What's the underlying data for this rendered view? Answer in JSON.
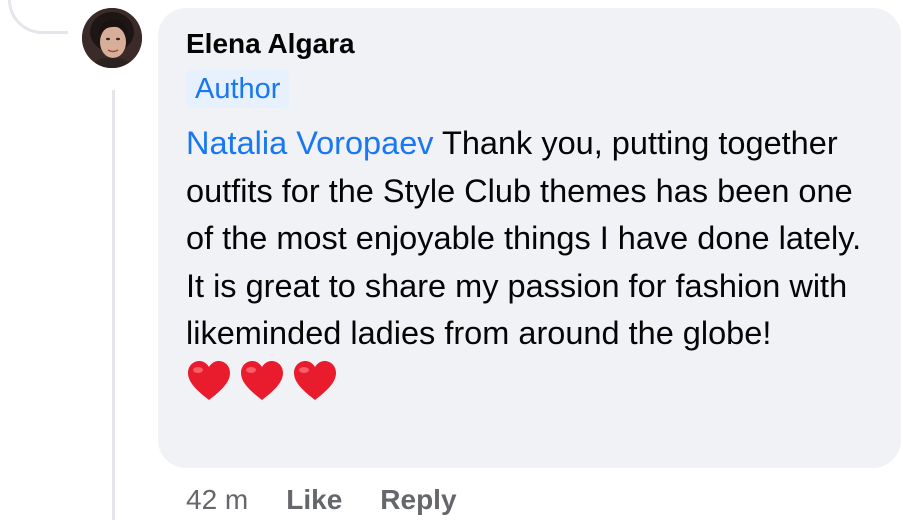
{
  "comment": {
    "author": "Elena Algara",
    "badge": "Author",
    "mention": "Natalia Voropaev",
    "text": " Thank you, putting together outfits for the Style Club themes has been one of the most enjoyable things I have done lately. It is great to share my passion for fashion with likeminded ladies from around the globe!",
    "reactions_icon": "red-heart-emoji",
    "reaction_count": 3
  },
  "actions": {
    "timestamp": "42 m",
    "like_label": "Like",
    "reply_label": "Reply"
  },
  "colors": {
    "bubble_bg": "#f0f2f5",
    "link_blue": "#1877f2",
    "badge_bg": "#e7f0fd",
    "secondary_text": "#65676b",
    "heart_red": "#e81c2c"
  }
}
